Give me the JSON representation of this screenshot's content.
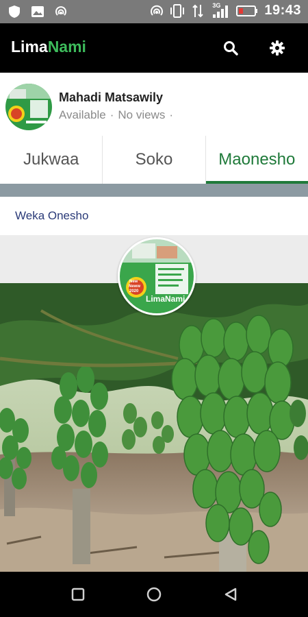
{
  "status_bar": {
    "time": "19:43",
    "network": "3G"
  },
  "app_bar": {
    "brand_part1": "Lima",
    "brand_part2": "Nami"
  },
  "profile": {
    "name": "Mahadi Matsawily",
    "status": "Available",
    "views": "No views"
  },
  "tabs": [
    {
      "label": "Jukwaa",
      "active": false
    },
    {
      "label": "Soko",
      "active": false
    },
    {
      "label": "Maonesho",
      "active": true
    }
  ],
  "add_show_label": "Weka Onesho",
  "logo": {
    "badge_line1": "New",
    "badge_line2": "Neww",
    "badge_year": "2020",
    "brand": "LimaNami"
  },
  "colors": {
    "accent": "#1f7a3a",
    "brand_green": "#3dbb5b",
    "link": "#2a3a78"
  }
}
